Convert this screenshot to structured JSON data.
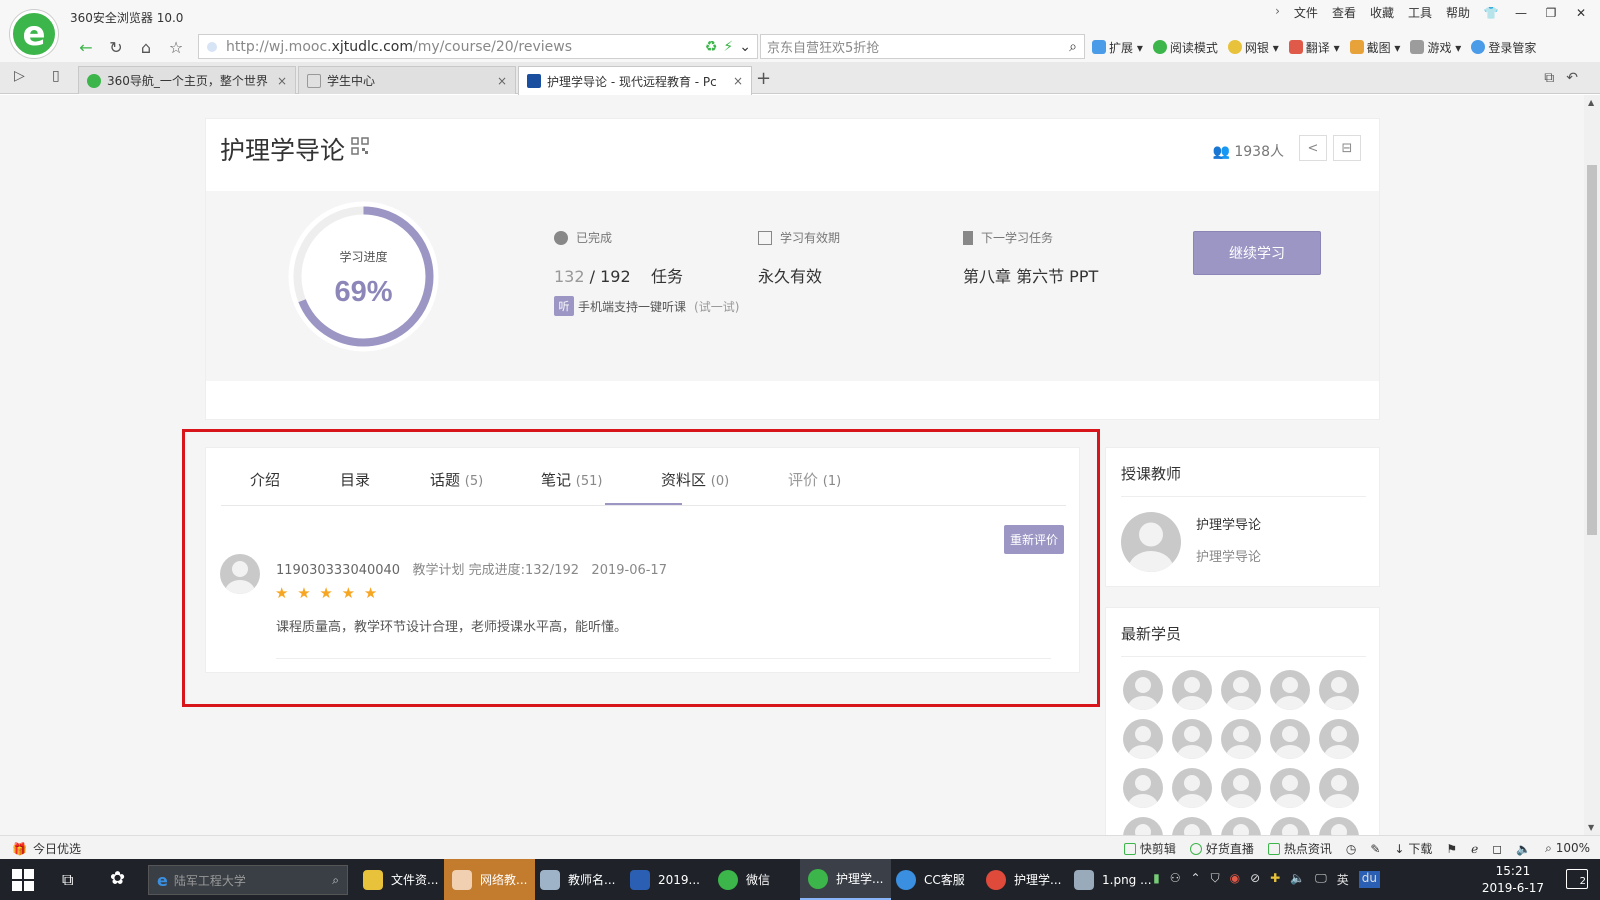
{
  "browser": {
    "title": "360安全浏览器 10.0",
    "menu": [
      "文件",
      "查看",
      "收藏",
      "工具",
      "帮助"
    ],
    "url_prefix": "http://wj.mooc.",
    "url_domain": "xjtudlc.com",
    "url_path": "/my/course/20/reviews",
    "search_placeholder": "京东自营狂欢5折抢",
    "extensions": [
      "扩展",
      "阅读模式",
      "网银",
      "翻译",
      "截图",
      "游戏",
      "登录管家"
    ],
    "tabs": [
      {
        "label": "360导航_一个主页，整个世界",
        "active": false,
        "color": "#3cb54a"
      },
      {
        "label": "学生中心",
        "active": false,
        "color": "#bbbbbb"
      },
      {
        "label": "护理学导论 - 现代远程教育 - Pc",
        "active": true,
        "color": "#1a4fa0"
      }
    ]
  },
  "course": {
    "title": "护理学导论",
    "student_count": "1938人",
    "progress_label": "学习进度",
    "progress_text": "69%",
    "progress_fraction": 0.69,
    "completed_label": "已完成",
    "completed_num": "132",
    "completed_total": "/ 192",
    "completed_unit": "任务",
    "validity_label": "学习有效期",
    "validity_value": "永久有效",
    "next_task_label": "下一学习任务",
    "next_task_value": "第八章 第六节 PPT",
    "listen_badge": "听",
    "listen_text": "手机端支持一键听课",
    "listen_try": "(试一试)",
    "continue_label": "继续学习"
  },
  "content_tabs": [
    {
      "label": "介绍",
      "count": ""
    },
    {
      "label": "目录",
      "count": ""
    },
    {
      "label": "话题",
      "count": "(5)"
    },
    {
      "label": "笔记",
      "count": "(51)"
    },
    {
      "label": "资料区",
      "count": "(0)"
    },
    {
      "label": "评价",
      "count": "(1)"
    }
  ],
  "review": {
    "re_review_label": "重新评价",
    "user": "119030333040040",
    "plan": "教学计划 完成进度:132/192",
    "date": "2019-06-17",
    "stars": "★ ★ ★ ★ ★",
    "rating": 5,
    "text": "课程质量高，教学环节设计合理，老师授课水平高，能听懂。"
  },
  "sidebar": {
    "teacher_title": "授课教师",
    "teacher_name": "护理学导论",
    "teacher_desc": "护理学导论",
    "students_title": "最新学员"
  },
  "statusbar": {
    "left": "今日优选",
    "right": [
      "快剪辑",
      "好货直播",
      "热点资讯",
      "下载",
      "100%"
    ]
  },
  "taskbar": {
    "search_text": "陆军工程大学",
    "tasks": [
      "文件资...",
      "网络教...",
      "教师名...",
      "2019...",
      "微信",
      "护理学...",
      "CC客服",
      "护理学...",
      "1.png ..."
    ],
    "ime": "英",
    "time": "15:21",
    "date": "2019-6-17",
    "notif_count": "2"
  }
}
